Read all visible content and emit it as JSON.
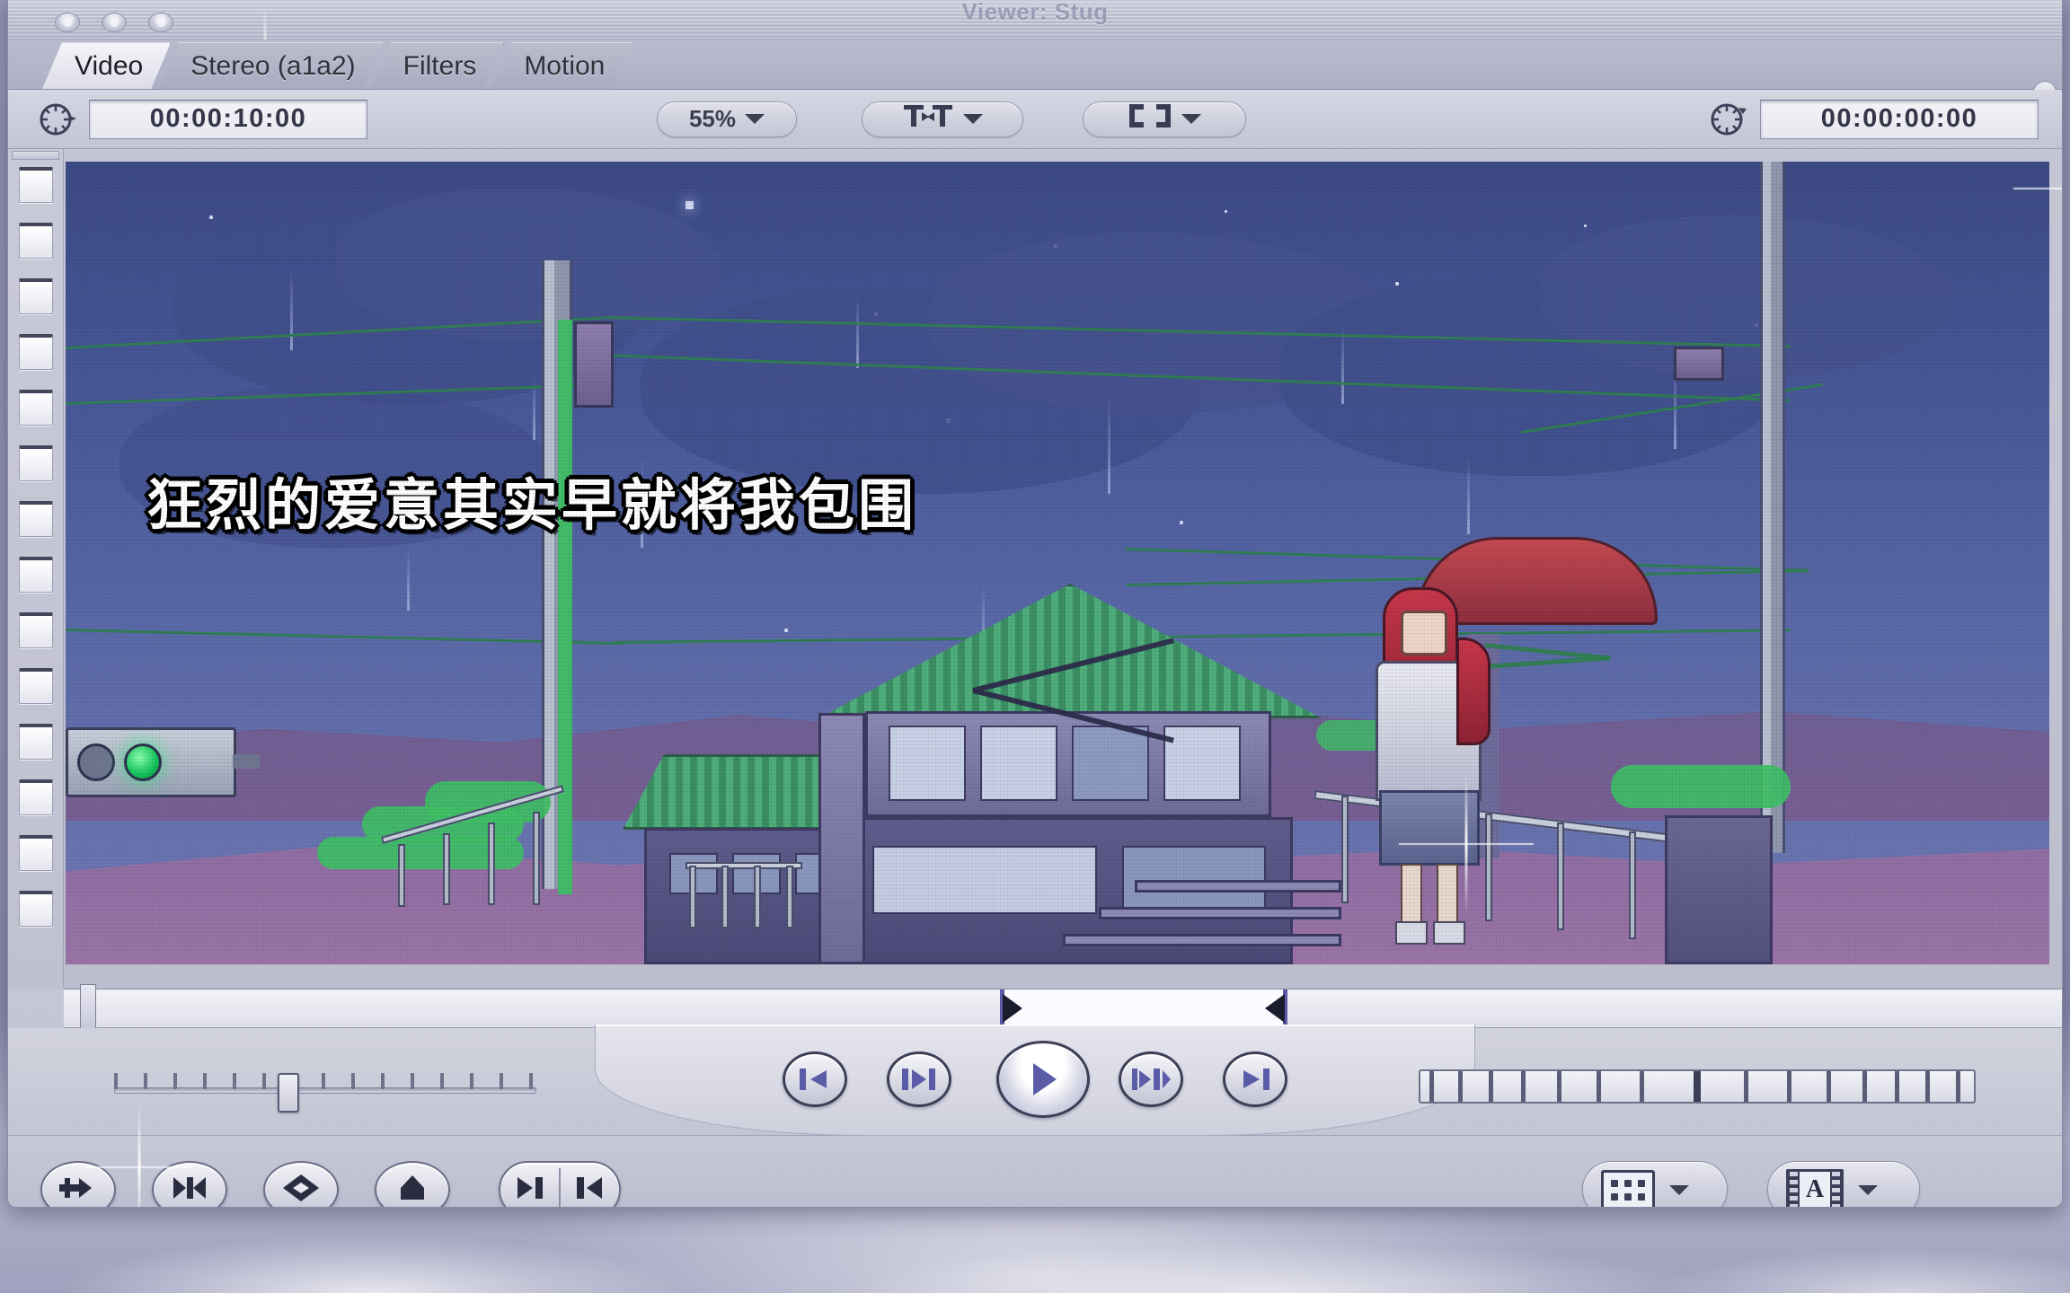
{
  "window": {
    "title": "Viewer: Stug",
    "traffic_lights": [
      "close",
      "minimize",
      "zoom"
    ]
  },
  "tabs": [
    {
      "label": "Video",
      "active": true
    },
    {
      "label": "Stereo (a1a2)",
      "active": false
    },
    {
      "label": "Filters",
      "active": false
    },
    {
      "label": "Motion",
      "active": false
    }
  ],
  "toolbar": {
    "left_timecode_icon": "clock-icon",
    "left_timecode": "00:00:10:00",
    "zoom_level": "55%",
    "zoom_caret": "chevron-down-icon",
    "view_mode_icon": "title-safe-icon",
    "view_mode_caret": "chevron-down-icon",
    "overlay_icon": "crop-brackets-icon",
    "overlay_caret": "chevron-down-icon",
    "right_timecode_icon": "clock-icon",
    "right_timecode": "00:00:00:00"
  },
  "video": {
    "subtitle": "狂烈的爱意其实早就将我包围",
    "scene_description": "pixel-art rainy night street with house, power pole, traffic light and girl with red umbrella",
    "colors": {
      "sky_top": "#3c4a86",
      "sky_bottom": "#6f79b4",
      "roof_green": "#4fae7b",
      "wire_green": "#2f7f52",
      "umbrella_red": "#c64a52",
      "signal_green": "#13c35a",
      "subtitle_fill": "#ffffff",
      "subtitle_outline": "#000000"
    }
  },
  "scrubber": {
    "in_marker": "mark-in-icon",
    "out_marker": "mark-out-icon",
    "playhead": "playhead-handle"
  },
  "transport": {
    "buttons": [
      {
        "name": "go-to-previous-edit-button",
        "icon": "previous-edit-icon"
      },
      {
        "name": "play-in-to-out-button",
        "icon": "play-in-to-out-icon"
      },
      {
        "name": "play-button",
        "icon": "play-icon"
      },
      {
        "name": "play-around-current-button",
        "icon": "play-around-icon"
      },
      {
        "name": "go-to-next-edit-button",
        "icon": "next-edit-icon"
      }
    ],
    "jog_control": "jog-slider",
    "shuttle_control": "shuttle-slider"
  },
  "bottom_bar": {
    "left_buttons": [
      {
        "name": "match-frame-button",
        "icon": "match-frame-icon"
      },
      {
        "name": "mark-clip-button",
        "icon": "mark-clip-icon"
      },
      {
        "name": "add-keyframe-button",
        "icon": "diamond-keyframe-icon"
      },
      {
        "name": "add-motion-keyframe-button",
        "icon": "motion-keyframe-icon"
      },
      {
        "name": "mark-in-out-button",
        "icon": "mark-in-out-split-icon"
      }
    ],
    "right_buttons": [
      {
        "name": "recent-clips-button",
        "icon": "grid-icon",
        "caret": "chevron-down-icon"
      },
      {
        "name": "generator-button",
        "icon": "film-a-icon",
        "caret": "chevron-down-icon"
      }
    ]
  }
}
